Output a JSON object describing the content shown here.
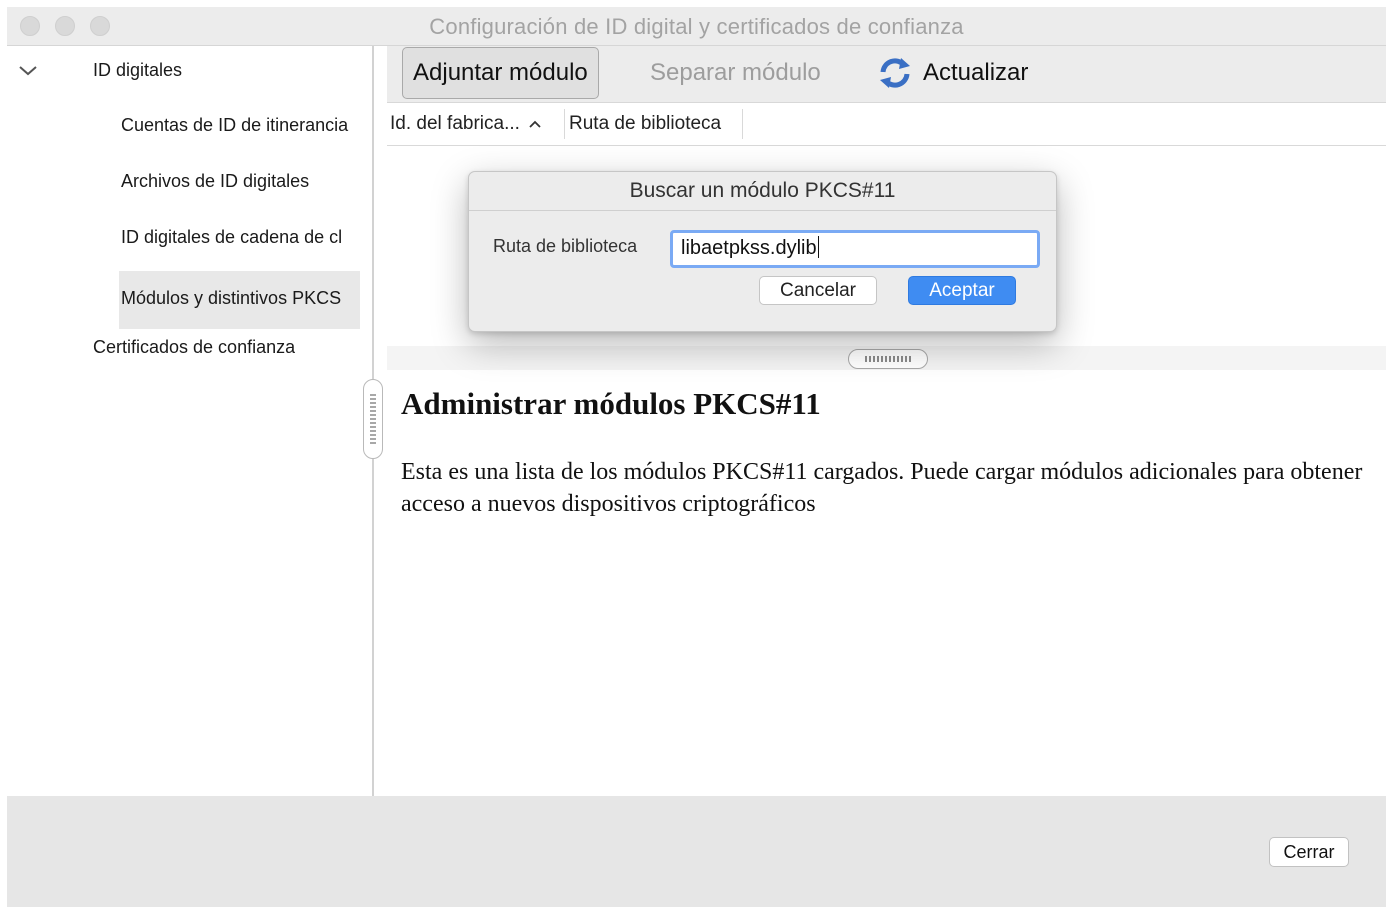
{
  "window": {
    "title": "Configuración de ID digital y certificados de confianza"
  },
  "sidebar": {
    "items": [
      {
        "label": "ID digitales",
        "expanded": true
      },
      {
        "label": "Cuentas de ID de itinerancia"
      },
      {
        "label": "Archivos de ID digitales"
      },
      {
        "label": "ID digitales de cadena de cl"
      },
      {
        "label": "Módulos y distintivos PKCS",
        "selected": true
      },
      {
        "label": "Certificados de confianza"
      }
    ]
  },
  "toolbar": {
    "attach_label": "Adjuntar módulo",
    "detach_label": "Separar módulo",
    "refresh_label": "Actualizar",
    "refresh_icon": "refresh-icon"
  },
  "table": {
    "columns": [
      {
        "label": "Id. del fabrica...",
        "sort": "ascending"
      },
      {
        "label": "Ruta de biblioteca"
      }
    ],
    "rows": []
  },
  "help": {
    "title": "Administrar módulos PKCS#11",
    "text": "Esta es una lista de los módulos PKCS#11 cargados. Puede cargar módulos adicionales para obtener acceso a nuevos dispositivos criptográficos"
  },
  "dialog": {
    "title": "Buscar un módulo PKCS#11",
    "field_label": "Ruta de biblioteca",
    "field_value": "libaetpkss.dylib",
    "cancel_label": "Cancelar",
    "ok_label": "Aceptar"
  },
  "footer": {
    "close_label": "Cerrar"
  },
  "colors": {
    "accent": "#3f8cf2",
    "focus_ring": "#7aaaf4",
    "refresh_icon": "#3a6fc4"
  }
}
